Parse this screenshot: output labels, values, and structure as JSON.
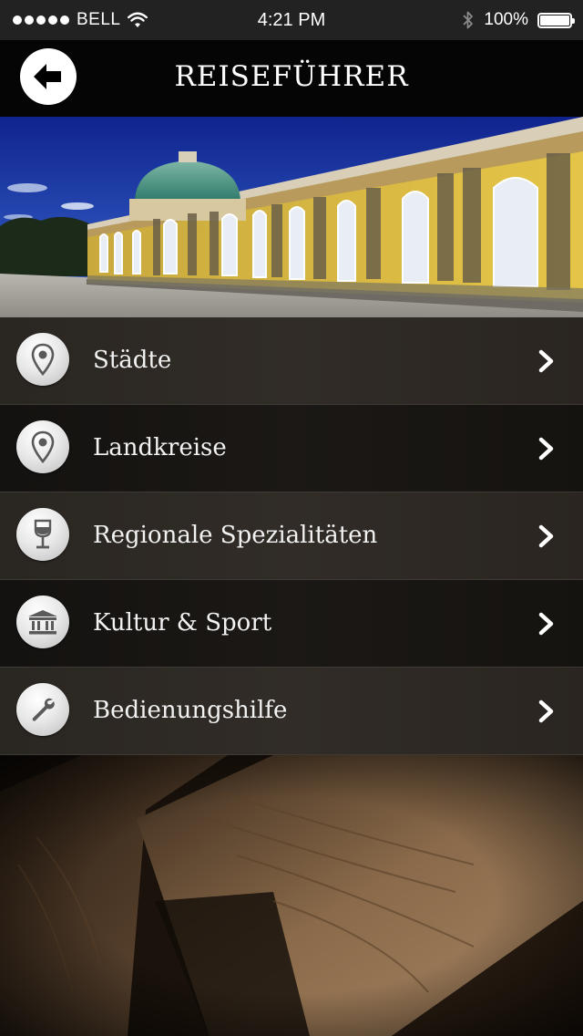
{
  "status_bar": {
    "carrier": "BELL",
    "time": "4:21 PM",
    "battery": "100%",
    "battery_level": 1.0
  },
  "navbar": {
    "title": "REISEFÜHRER",
    "back_icon": "arrow-left-icon"
  },
  "hero": {
    "image": "palace-photo"
  },
  "menu": {
    "items": [
      {
        "label": "Städte",
        "icon": "map-pin-icon"
      },
      {
        "label": "Landkreise",
        "icon": "map-pin-icon"
      },
      {
        "label": "Regionale Spezialitäten",
        "icon": "wine-glass-icon"
      },
      {
        "label": "Kultur & Sport",
        "icon": "museum-icon"
      },
      {
        "label": "Bedienungshilfe",
        "icon": "wrench-icon"
      }
    ]
  },
  "colors": {
    "nav_bg": "#050505",
    "status_bg": "#222222",
    "row_light": "#2e2a25",
    "row_dark": "#171512",
    "text": "#f2f2f2"
  }
}
